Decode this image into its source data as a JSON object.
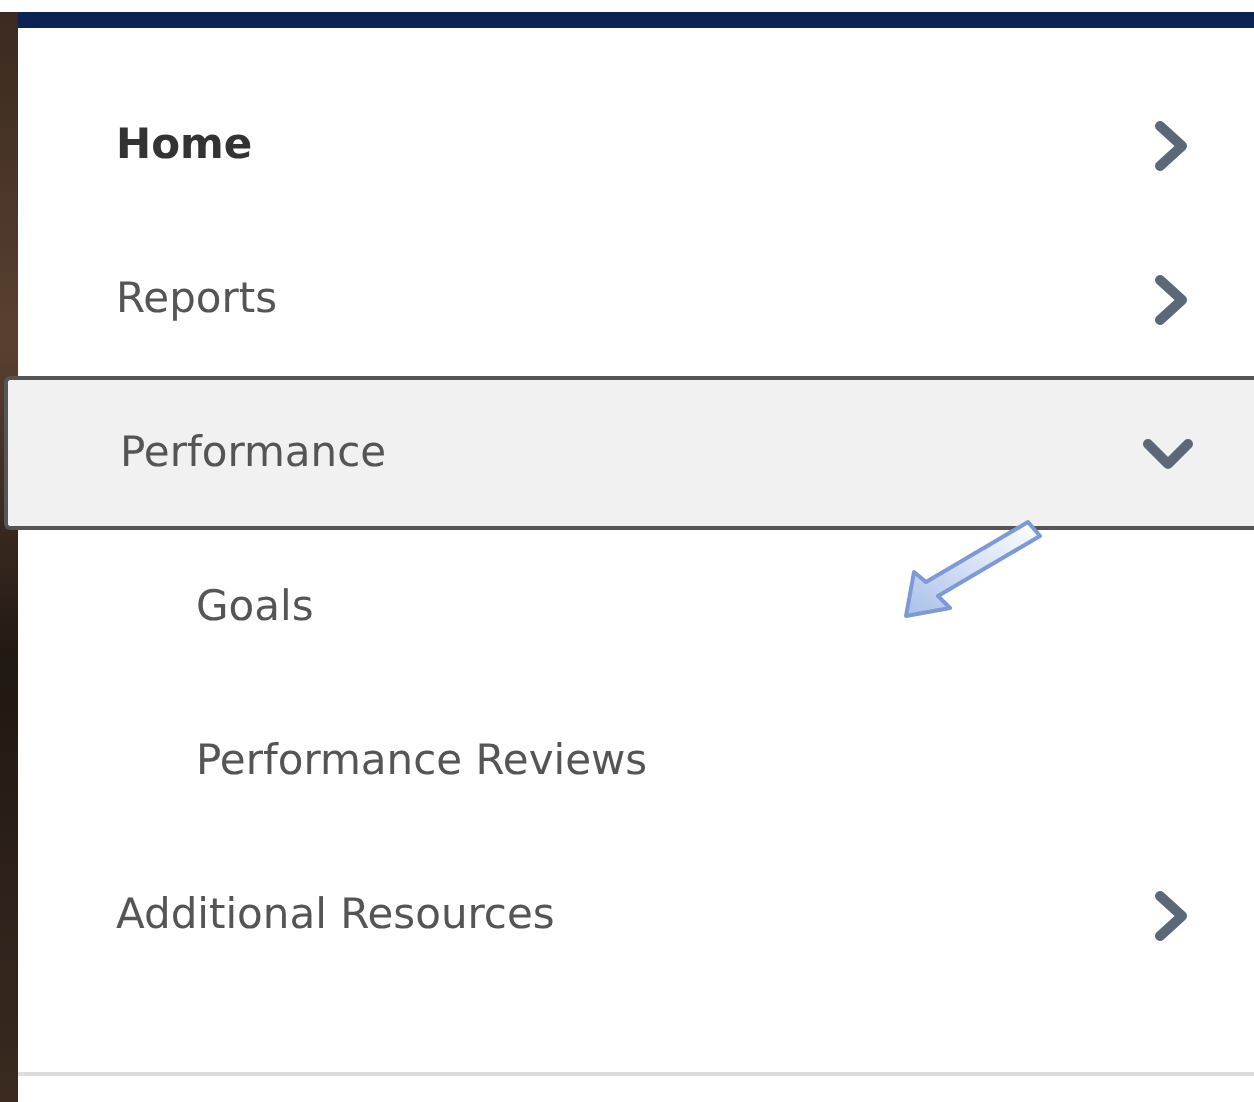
{
  "menu": {
    "items": [
      {
        "label": "Home",
        "selected": true,
        "expanded": false
      },
      {
        "label": "Reports",
        "selected": false,
        "expanded": false
      },
      {
        "label": "Performance",
        "selected": false,
        "expanded": true,
        "children": [
          {
            "label": "Goals"
          },
          {
            "label": "Performance Reviews"
          }
        ]
      },
      {
        "label": "Additional Resources",
        "selected": false,
        "expanded": false
      }
    ]
  }
}
